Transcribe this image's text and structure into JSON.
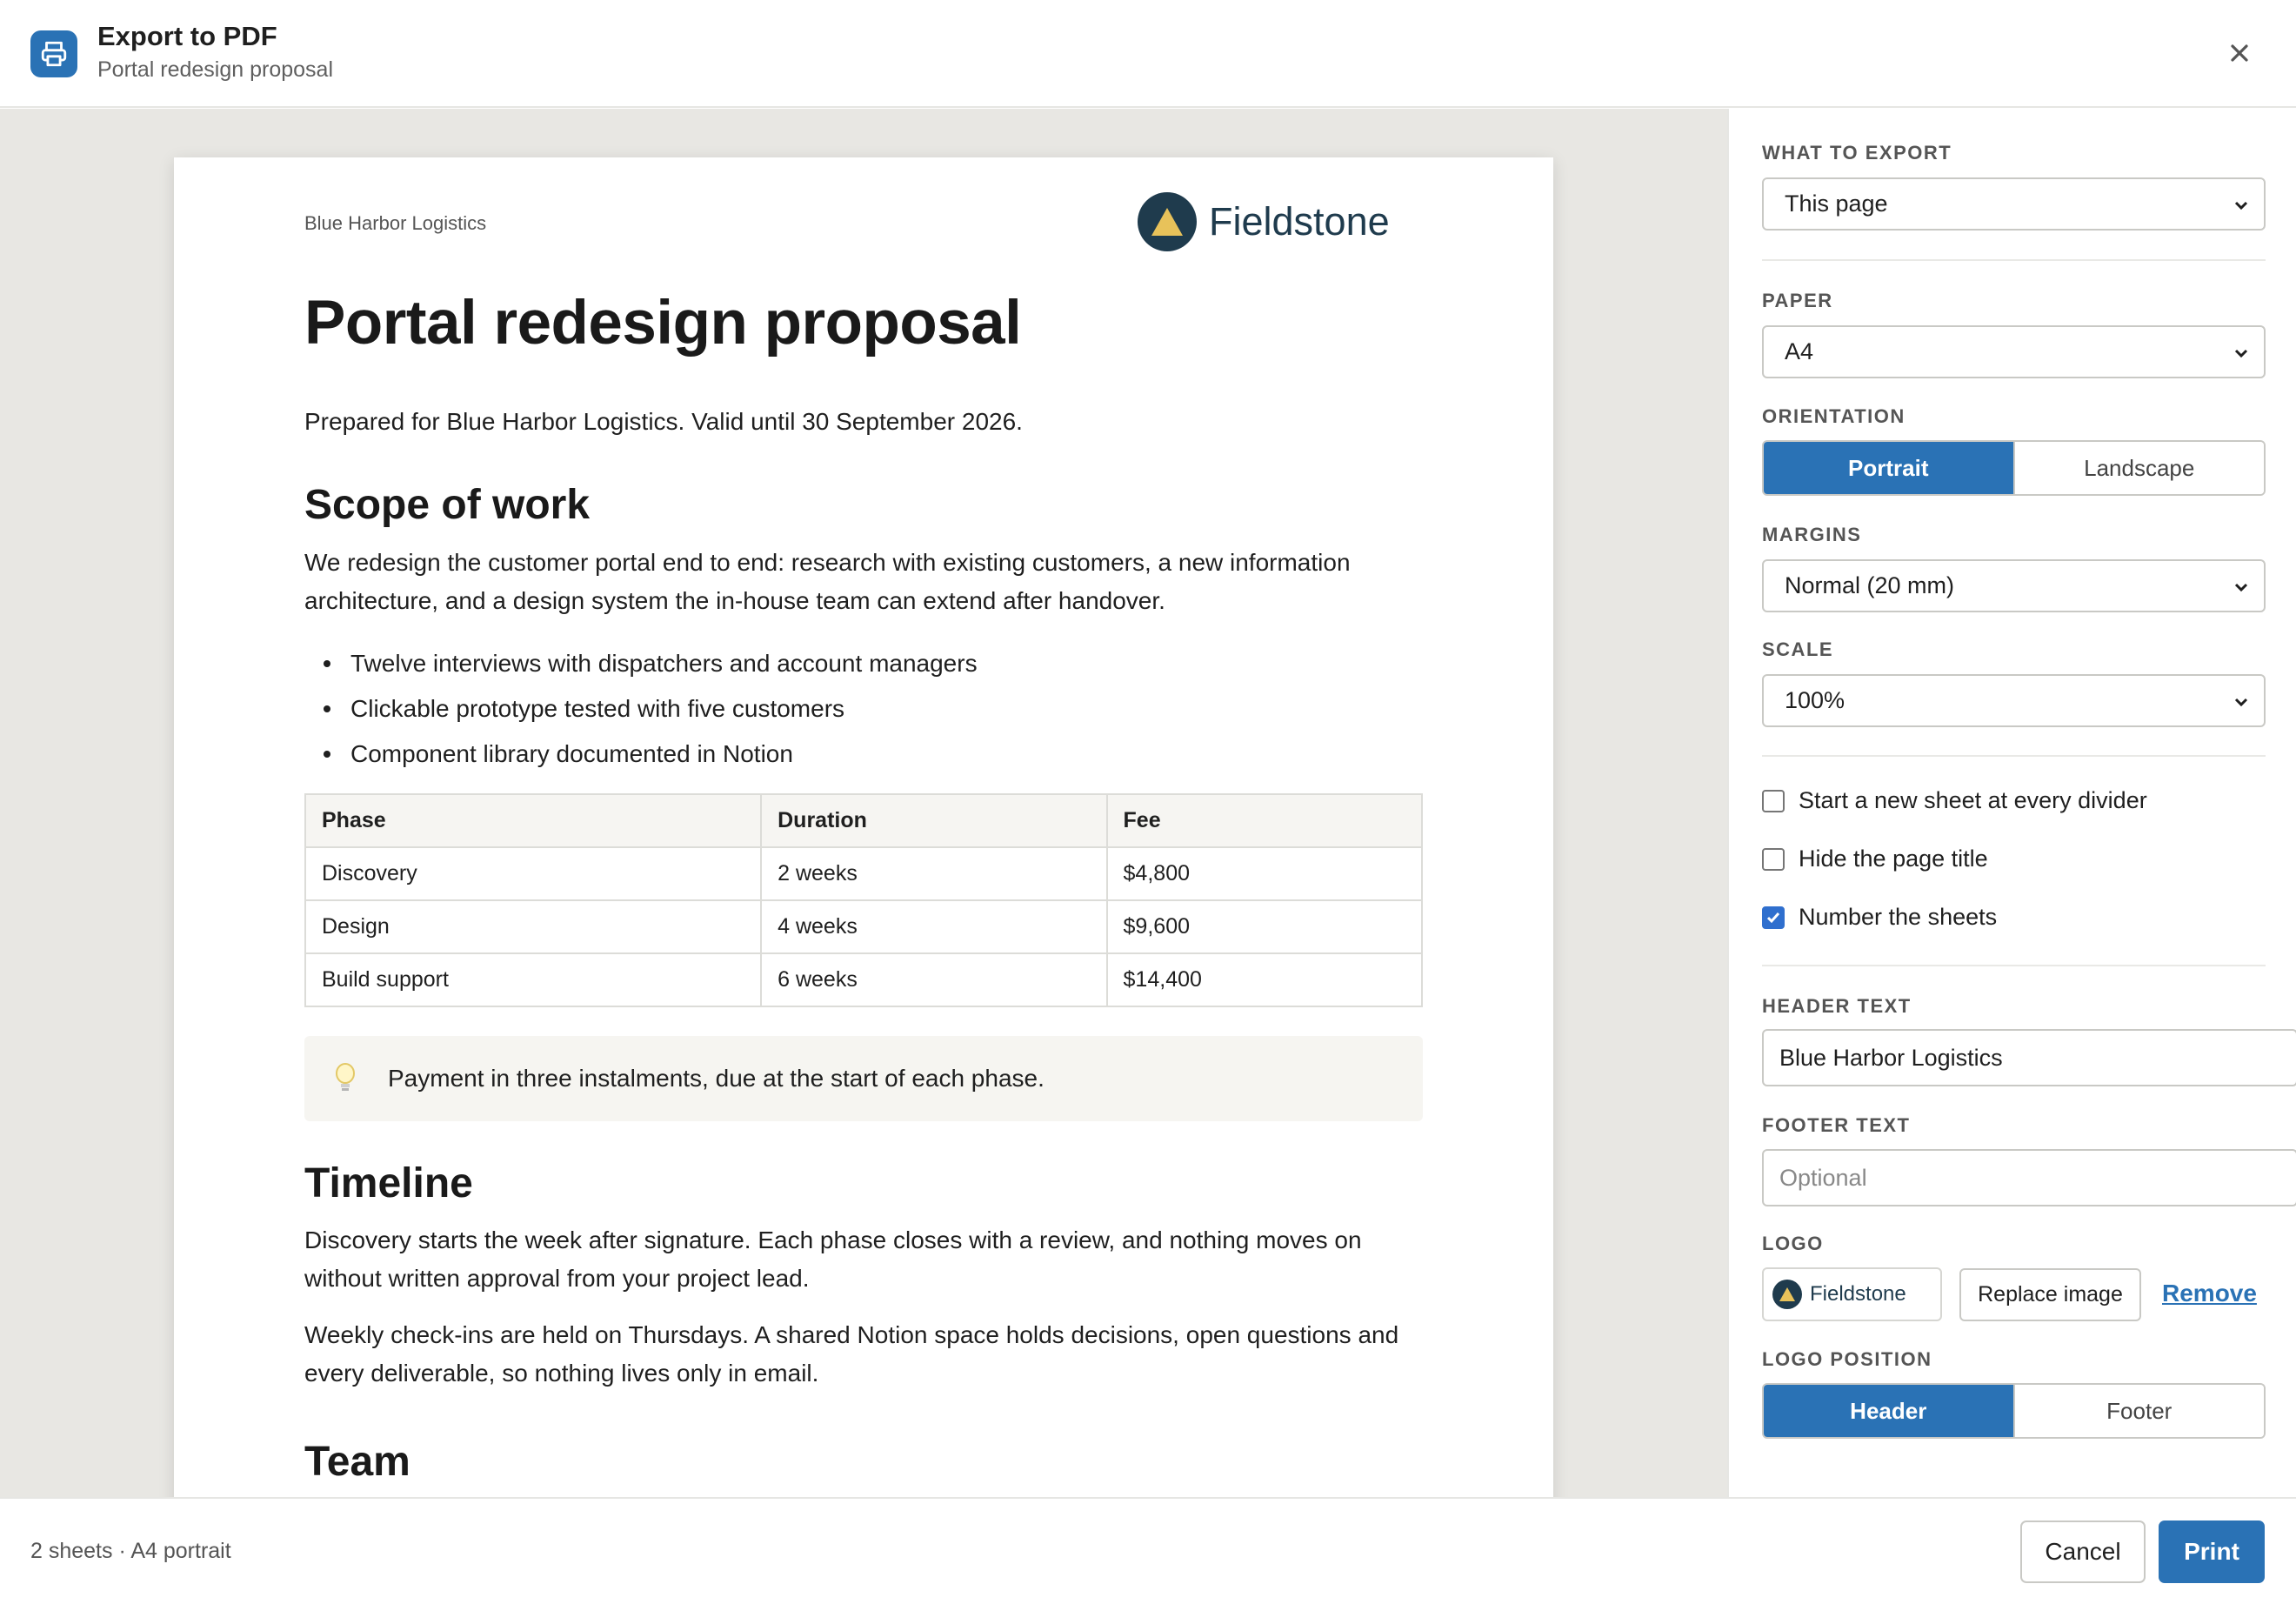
{
  "dialog": {
    "title": "Export to PDF",
    "subtitle": "Portal redesign proposal",
    "close_icon": "close-icon",
    "print_icon": "printer-icon"
  },
  "document": {
    "header_text": "Blue Harbor Logistics",
    "logo_name": "Fieldstone",
    "title": "Portal redesign proposal",
    "lead": "Prepared for Blue Harbor Logistics. Valid until 30 September 2026.",
    "section1_heading": "Scope of work",
    "section1_body": "We redesign the customer portal end to end: research with existing customers, a new information architecture, and a design system the in-house team can extend after handover.",
    "bullets": [
      "Twelve interviews with dispatchers and account managers",
      "Clickable prototype tested with five customers",
      "Component library documented in Notion"
    ],
    "table": {
      "headers": [
        "Phase",
        "Duration",
        "Fee"
      ],
      "rows": [
        [
          "Discovery",
          "2 weeks",
          "$4,800"
        ],
        [
          "Design",
          "4 weeks",
          "$9,600"
        ],
        [
          "Build support",
          "6 weeks",
          "$14,400"
        ]
      ]
    },
    "callout_icon": "lightbulb-icon",
    "callout": "Payment in three instalments, due at the start of each phase.",
    "section2_heading": "Timeline",
    "section2_para1": "Discovery starts the week after signature. Each phase closes with a review, and nothing moves on without written approval from your project lead.",
    "section2_para2": "Weekly check-ins are held on Thursdays. A shared Notion space holds decisions, open questions and every deliverable, so nothing lives only in email.",
    "section3_heading": "Team"
  },
  "settings": {
    "what_to_export": {
      "label": "WHAT TO EXPORT",
      "value": "This page"
    },
    "paper": {
      "label": "PAPER",
      "value": "A4"
    },
    "orientation": {
      "label": "ORIENTATION",
      "options": [
        "Portrait",
        "Landscape"
      ],
      "selected": "Portrait"
    },
    "margins": {
      "label": "MARGINS",
      "value": "Normal (20 mm)"
    },
    "scale": {
      "label": "SCALE",
      "value": "100%"
    },
    "checkboxes": [
      {
        "label": "Start a new sheet at every divider",
        "checked": false
      },
      {
        "label": "Hide the page title",
        "checked": false
      },
      {
        "label": "Number the sheets",
        "checked": true
      }
    ],
    "header_text": {
      "label": "HEADER TEXT",
      "value": "Blue Harbor Logistics"
    },
    "footer_text": {
      "label": "FOOTER TEXT",
      "value": "",
      "placeholder": "Optional"
    },
    "logo": {
      "label": "LOGO",
      "chip_name": "Fieldstone",
      "replace_label": "Replace image",
      "remove_label": "Remove"
    },
    "logo_position": {
      "label": "LOGO POSITION",
      "options": [
        "Header",
        "Footer"
      ],
      "selected": "Header"
    }
  },
  "footer": {
    "status": "2 sheets · A4 portrait",
    "cancel_label": "Cancel",
    "print_label": "Print"
  },
  "colors": {
    "accent": "#2a72b5",
    "logo_dark": "#1f3b4d",
    "logo_gold": "#e8c25a",
    "preview_bg": "#e8e7e3"
  }
}
